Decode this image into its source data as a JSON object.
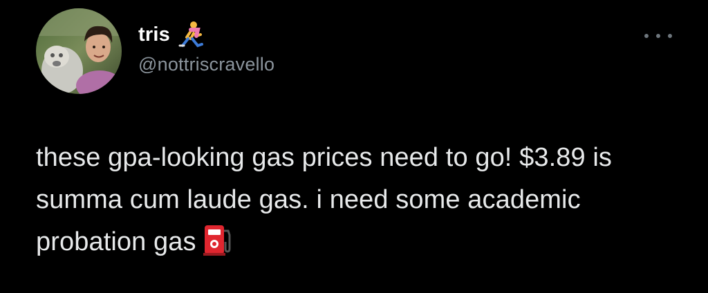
{
  "tweet": {
    "author": {
      "display_name": "tris",
      "name_emoji": "person-running-icon",
      "handle": "@nottriscravello",
      "avatar": "profile-photo"
    },
    "menu_icon": "more-options-icon",
    "text": "these gpa-looking gas prices need to go! $3.89 is summa cum laude gas. i need some academic probation gas",
    "text_emoji": "fuel-pump-icon"
  },
  "colors": {
    "background": "#000000",
    "name": "#ffffff",
    "handle": "#8b949c",
    "body_text": "#e7e9ea",
    "accent_pump": "#e0262f"
  }
}
